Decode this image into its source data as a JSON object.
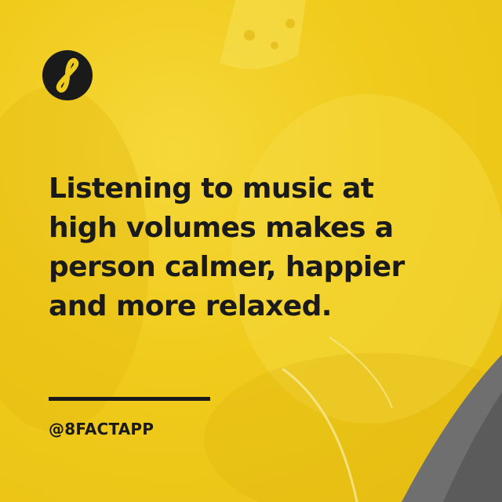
{
  "brand": {
    "logo_icon": "infinity-eight-icon",
    "handle": "@8FACTAPP"
  },
  "fact": {
    "lines": [
      "Listening to music at",
      "high volumes makes a",
      "person calmer, happier",
      "and more relaxed."
    ]
  },
  "colors": {
    "background": "#f0cb1c",
    "text": "#1a1a1a",
    "logo_mark": "#f0cb1c"
  }
}
